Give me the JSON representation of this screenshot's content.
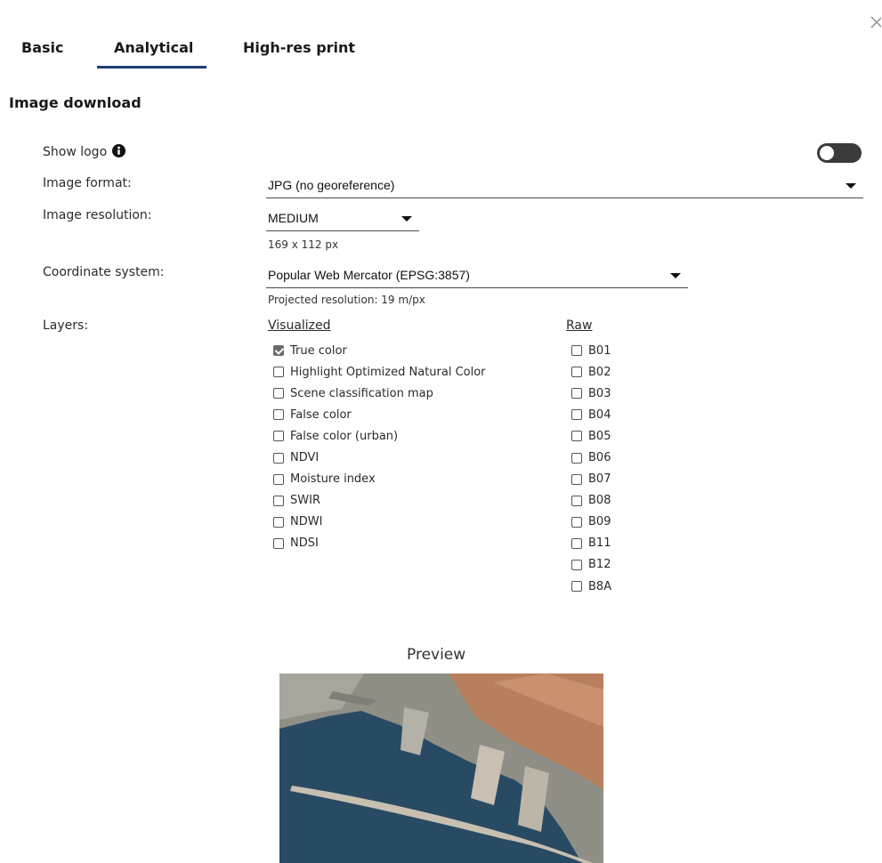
{
  "tabs": [
    {
      "label": "Basic",
      "active": false
    },
    {
      "label": "Analytical",
      "active": true
    },
    {
      "label": "High-res print",
      "active": false
    }
  ],
  "section_title": "Image download",
  "show_logo": {
    "label": "Show logo",
    "enabled": false,
    "icon": "info-icon"
  },
  "image_format": {
    "label": "Image format:",
    "value": "JPG (no georeference)"
  },
  "image_resolution": {
    "label": "Image resolution:",
    "value": "MEDIUM",
    "hint": "169 x 112 px"
  },
  "coordinate_system": {
    "label": "Coordinate system:",
    "value": "Popular Web Mercator (EPSG:3857)",
    "hint": "Projected resolution: 19 m/px"
  },
  "layers": {
    "label": "Layers:",
    "visualized": {
      "heading": "Visualized",
      "items": [
        {
          "label": "True color",
          "checked": true
        },
        {
          "label": "Highlight Optimized Natural Color",
          "checked": false
        },
        {
          "label": "Scene classification map",
          "checked": false
        },
        {
          "label": "False color",
          "checked": false
        },
        {
          "label": "False color (urban)",
          "checked": false
        },
        {
          "label": "NDVI",
          "checked": false
        },
        {
          "label": "Moisture index",
          "checked": false
        },
        {
          "label": "SWIR",
          "checked": false
        },
        {
          "label": "NDWI",
          "checked": false
        },
        {
          "label": "NDSI",
          "checked": false
        }
      ]
    },
    "raw": {
      "heading": "Raw",
      "items": [
        {
          "label": "B01",
          "checked": false
        },
        {
          "label": "B02",
          "checked": false
        },
        {
          "label": "B03",
          "checked": false
        },
        {
          "label": "B04",
          "checked": false
        },
        {
          "label": "B05",
          "checked": false
        },
        {
          "label": "B06",
          "checked": false
        },
        {
          "label": "B07",
          "checked": false
        },
        {
          "label": "B08",
          "checked": false
        },
        {
          "label": "B09",
          "checked": false
        },
        {
          "label": "B11",
          "checked": false
        },
        {
          "label": "B12",
          "checked": false
        },
        {
          "label": "B8A",
          "checked": false
        }
      ]
    }
  },
  "preview": {
    "title": "Preview"
  },
  "colors": {
    "accent": "#1d3f74",
    "toggle_off": "#3b3b3b",
    "checkbox_checked": "#6b6b6b"
  }
}
